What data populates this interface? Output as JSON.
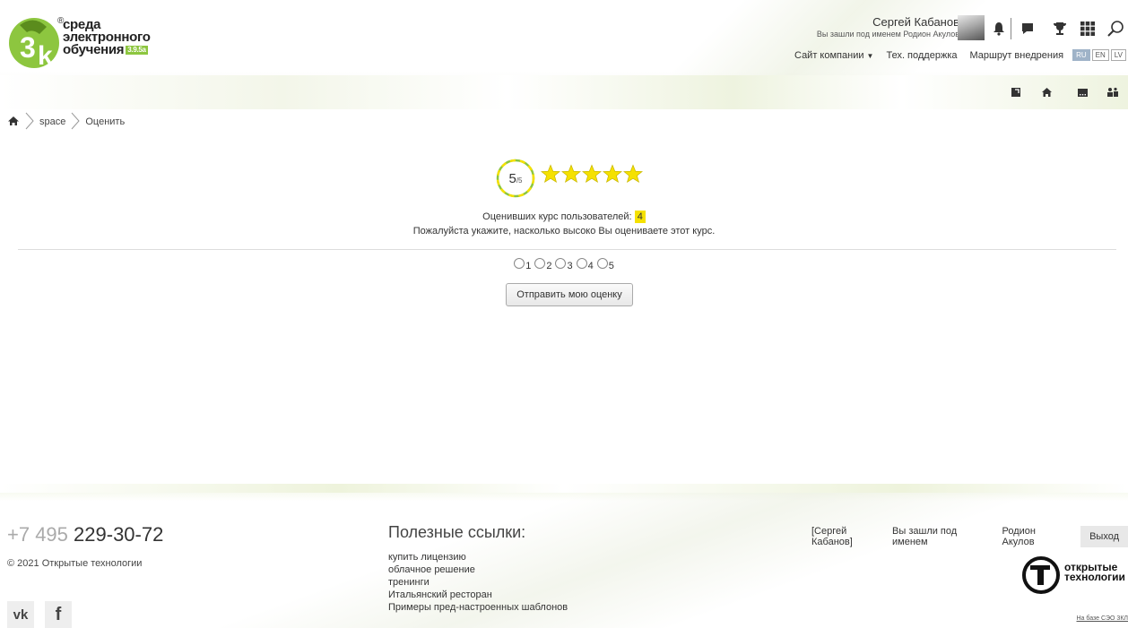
{
  "header": {
    "logo": {
      "line1": "среда",
      "line2": "электронного",
      "line3": "обучения",
      "version": "3.9.5a"
    },
    "user": {
      "name": "Сергей Кабанов",
      "impersonation": "Вы зашли под именем Родион Акулов"
    },
    "nav": {
      "company": "Сайт компании",
      "support": "Тех. поддержка",
      "route": "Маршрут внедрения"
    },
    "langs": [
      "RU",
      "EN",
      "LV"
    ],
    "icons": [
      "bell-icon",
      "chat-icon",
      "trophy-icon",
      "grid-icon",
      "search-icon"
    ],
    "quick_icons": [
      "bookmark-icon",
      "home-icon",
      "message-icon",
      "users-icon"
    ]
  },
  "breadcrumb": {
    "home_icon": "home-icon",
    "items": [
      "space",
      "Оценить"
    ]
  },
  "rating": {
    "score": "5",
    "of": "/5",
    "stars_filled": 5,
    "stars_total": 5,
    "raters_label": "Оценивших курс пользователей:",
    "raters_count": "4",
    "prompt": "Пожалуйста укажите, насколько высоко Вы оцениваете этот курс.",
    "options": [
      "1",
      "2",
      "3",
      "4",
      "5"
    ],
    "submit_label": "Отправить мою оценку"
  },
  "footer": {
    "phone_code": "+7 495",
    "phone_number": "229-30-72",
    "copyright": "© 2021 Открытые технологии",
    "links_title": "Полезные ссылки:",
    "links": [
      "купить лицензию",
      "облачное решение",
      "тренинги",
      "Итальянский ресторан",
      "Примеры пред-настроенных шаблонов"
    ],
    "user_link": "[Сергей Кабанов]",
    "impersonation_text": "Вы зашли под именем",
    "impersonated": "Родион Акулов",
    "logout": "Выход",
    "company_logo_line1": "открытые",
    "company_logo_line2": "технологии",
    "based_on": "На базе СЭО 3КЛ",
    "social": [
      "vk-icon",
      "facebook-icon"
    ]
  },
  "colors": {
    "accent_green": "#8dc63f",
    "star_yellow": "#f5e100",
    "lang_active": "#9fb3c8"
  }
}
